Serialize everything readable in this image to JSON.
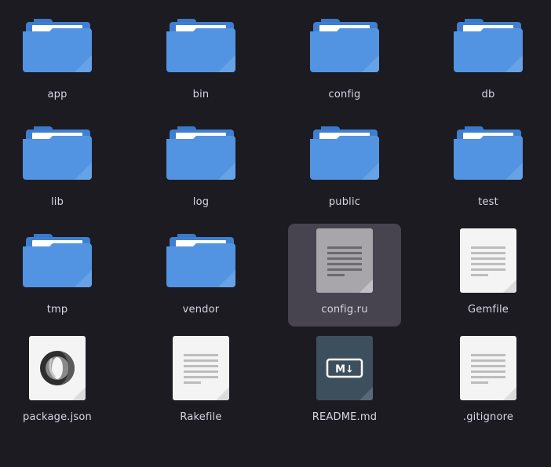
{
  "colors": {
    "background": "#1c1b22",
    "selection": "#47434f",
    "folder_blue": "#4a90e2",
    "text": "#d9d4e3"
  },
  "items": [
    {
      "label": "app",
      "type": "folder",
      "icon": "folder-icon"
    },
    {
      "label": "bin",
      "type": "folder",
      "icon": "folder-icon"
    },
    {
      "label": "config",
      "type": "folder",
      "icon": "folder-icon"
    },
    {
      "label": "db",
      "type": "folder",
      "icon": "folder-icon"
    },
    {
      "label": "lib",
      "type": "folder",
      "icon": "folder-icon"
    },
    {
      "label": "log",
      "type": "folder",
      "icon": "folder-icon"
    },
    {
      "label": "public",
      "type": "folder",
      "icon": "folder-icon"
    },
    {
      "label": "test",
      "type": "folder",
      "icon": "folder-icon"
    },
    {
      "label": "tmp",
      "type": "folder",
      "icon": "folder-icon"
    },
    {
      "label": "vendor",
      "type": "folder",
      "icon": "folder-icon"
    },
    {
      "label": "config.ru",
      "type": "text-file",
      "icon": "text-file-icon",
      "selected": true
    },
    {
      "label": "Gemfile",
      "type": "text-file",
      "icon": "text-file-icon"
    },
    {
      "label": "package.json",
      "type": "json-file",
      "icon": "json-file-icon"
    },
    {
      "label": "Rakefile",
      "type": "text-file",
      "icon": "text-file-icon"
    },
    {
      "label": "README.md",
      "type": "markdown-file",
      "icon": "markdown-file-icon",
      "badge": "M↓"
    },
    {
      "label": ".gitignore",
      "type": "text-file",
      "icon": "text-file-icon"
    }
  ]
}
